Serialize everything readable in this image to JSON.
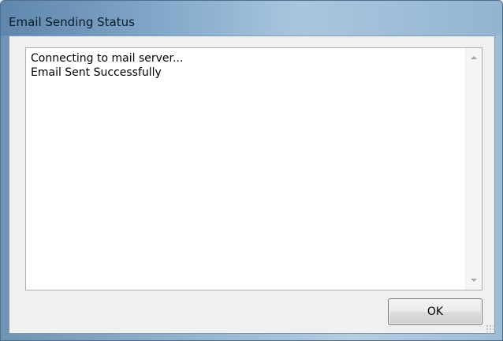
{
  "window": {
    "title": "Email Sending Status"
  },
  "log": {
    "lines": [
      "Connecting to mail server...",
      "Email Sent Successfully"
    ]
  },
  "buttons": {
    "ok_label": "OK"
  },
  "icons": {
    "scroll_up": "scroll-up-arrow-icon",
    "scroll_down": "scroll-down-arrow-icon",
    "resize_grip": "resize-grip-icon"
  }
}
